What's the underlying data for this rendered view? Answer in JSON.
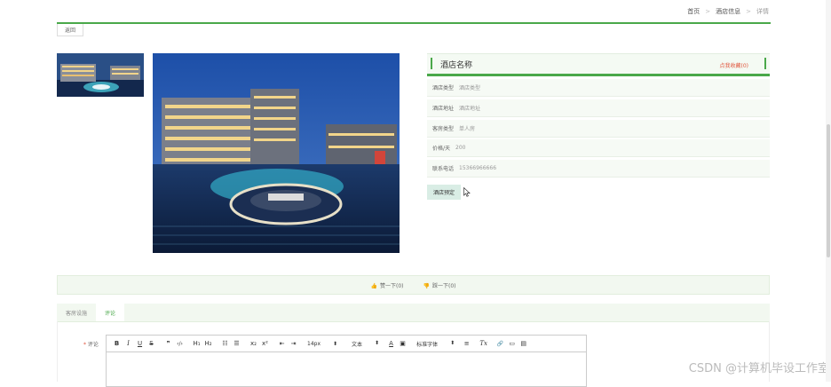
{
  "breadcrumb": {
    "home": "首页",
    "hotel_info": "酒店信息",
    "current": "详情",
    "separator": ">"
  },
  "back_label": "返回",
  "hotel": {
    "name": "酒店名称",
    "favorite_label": "点我收藏(0)",
    "fields": [
      {
        "key": "酒店类型",
        "value": "酒店类型"
      },
      {
        "key": "酒店地址",
        "value": "酒店地址"
      },
      {
        "key": "客房类型",
        "value": "单人房"
      },
      {
        "key": "价格/天",
        "value": "200"
      },
      {
        "key": "联系电话",
        "value": "15366966666"
      }
    ],
    "book_label": "酒店预定"
  },
  "vote": {
    "up_label": "赞一下(0)",
    "down_label": "踩一下(0)"
  },
  "tabs": [
    {
      "label": "客房设施"
    },
    {
      "label": "评论"
    }
  ],
  "comment": {
    "required_mark": "*",
    "label": "评论",
    "toolbar": {
      "bold": "B",
      "italic": "I",
      "underline": "U",
      "strike": "S",
      "quote": "❞",
      "code": "‹/›",
      "h1": "H₁",
      "h2": "H₂",
      "ordered_list": "☷",
      "bullet_list": "☰",
      "subscript": "x₂",
      "superscript": "x²",
      "indent_less": "⇤",
      "indent_more": "⇥",
      "font_size": "14px",
      "header_select": "文本",
      "font_family": "标准字体",
      "color": "A",
      "background": "▣",
      "align": "≡",
      "clean": "Tx",
      "link": "🔗",
      "image": "▭",
      "video": "▤"
    }
  },
  "watermark": "CSDN @计算机毕设工作室",
  "colors": {
    "accent": "#4aa84a",
    "favorite": "#e0533a",
    "panel_bg": "#f6faf5",
    "book_bg": "#d9ede5"
  }
}
